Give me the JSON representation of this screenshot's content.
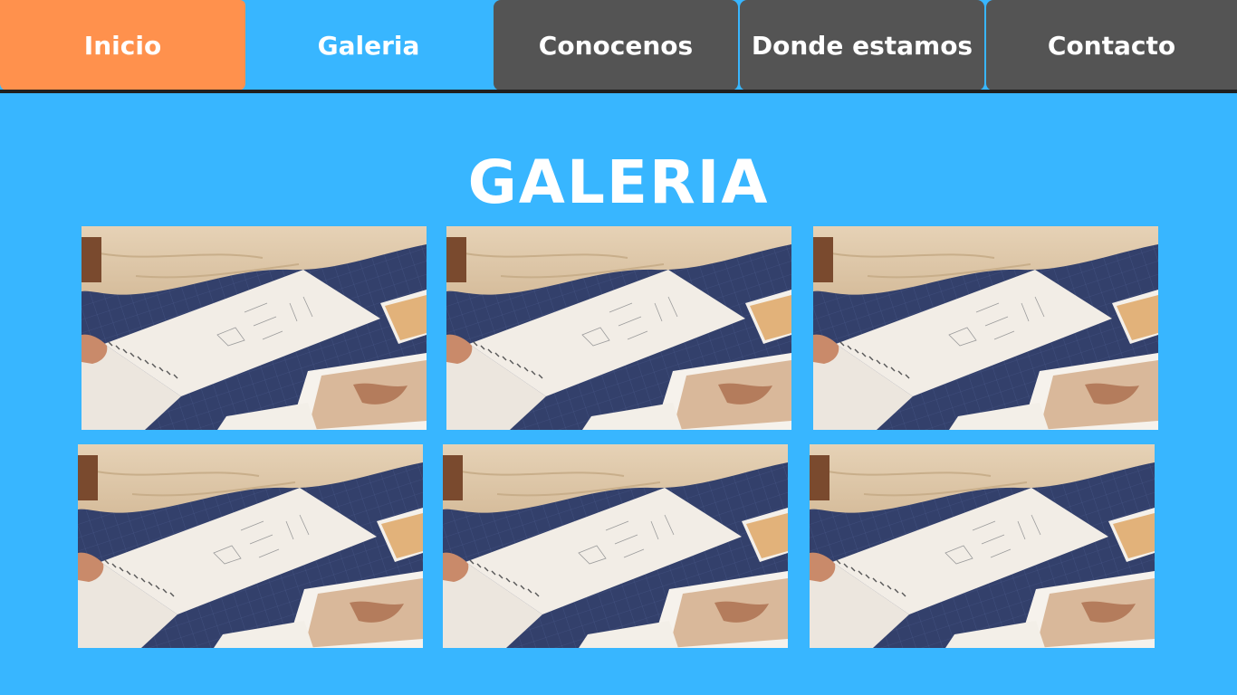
{
  "nav": {
    "tabs": [
      {
        "label": "Inicio",
        "color": "#FF914D"
      },
      {
        "label": "Galeria",
        "color": "#38B6FF"
      },
      {
        "label": "Conocenos",
        "color": "#545454"
      },
      {
        "label": "Donde estamos",
        "color": "#545454"
      },
      {
        "label": "Contacto",
        "color": "#545454"
      }
    ]
  },
  "page": {
    "title": "GALERIA",
    "background": "#38B6FF"
  },
  "gallery": {
    "images": [
      {
        "subject": "sketchbook-on-cutting-mat"
      },
      {
        "subject": "sketchbook-on-cutting-mat"
      },
      {
        "subject": "sketchbook-on-cutting-mat"
      },
      {
        "subject": "sketchbook-on-cutting-mat"
      },
      {
        "subject": "sketchbook-on-cutting-mat"
      },
      {
        "subject": "sketchbook-on-cutting-mat"
      }
    ]
  }
}
